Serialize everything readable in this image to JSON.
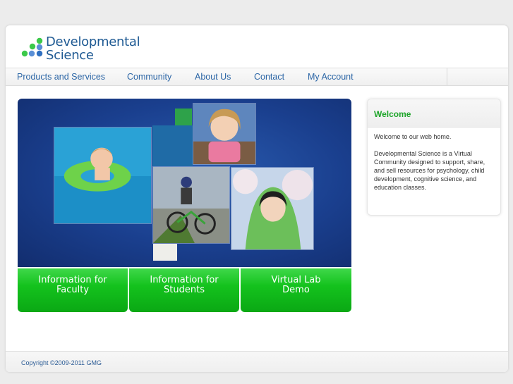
{
  "brand": {
    "name_line1": "Developmental",
    "name_line2": "Science",
    "dot_colors": [
      "#3cc94a",
      "#5a8fd6",
      "#2f6fc1"
    ]
  },
  "nav": {
    "items": [
      "Products and Services",
      "Community",
      "About Us",
      "Contact",
      "My Account"
    ]
  },
  "buttons": {
    "faculty_line1": "Information for",
    "faculty_line2": "Faculty",
    "students_line1": "Information for",
    "students_line2": "Students",
    "lab_line1": "Virtual Lab",
    "lab_line2": "Demo"
  },
  "welcome": {
    "title": "Welcome",
    "intro": "Welcome to our web home.",
    "body": "Developmental Science is a Virtual Community designed to support, share, and sell resources for psychology, child development, cognitive science, and education classes."
  },
  "footer": {
    "copyright": "Copyright ©2009-2011 GMG"
  },
  "colors": {
    "accent_green": "#1ea52a",
    "link_blue": "#2c66a6",
    "banner_blue": "#1a3f8e"
  }
}
